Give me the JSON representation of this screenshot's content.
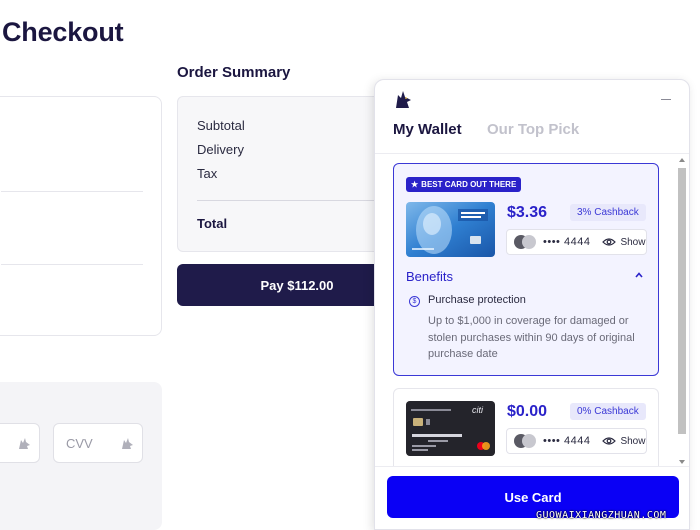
{
  "page": {
    "title": "Checkout"
  },
  "payment_form": {
    "cvv_placeholder": "CVV"
  },
  "order_summary": {
    "title": "Order Summary",
    "rows": [
      {
        "label": "Subtotal"
      },
      {
        "label": "Delivery"
      },
      {
        "label": "Tax"
      }
    ],
    "total_label": "Total",
    "pay_button": "Pay $112.00"
  },
  "wallet": {
    "tabs": [
      {
        "label": "My Wallet",
        "active": true
      },
      {
        "label": "Our Top Pick",
        "active": false
      }
    ],
    "cards": [
      {
        "badge": "BEST CARD OUT THERE",
        "card_type": "amex-blue",
        "amount": "$3.36",
        "cashback": "3% Cashback",
        "masked": "•••• 4444",
        "show_label": "Show",
        "benefits": {
          "label": "Benefits",
          "expanded": true,
          "items": [
            {
              "title": "Purchase protection",
              "description": "Up to $1,000 in coverage for damaged or stolen purchases within 90 days of original purchase date"
            }
          ]
        }
      },
      {
        "card_type": "citi-black",
        "amount": "$0.00",
        "cashback": "0% Cashback",
        "masked": "•••• 4444",
        "show_label": "Show"
      }
    ],
    "use_button": "Use Card"
  },
  "watermark": "GUOWAIXIANGZHUAN.COM",
  "colors": {
    "navy": "#1f1b4a",
    "accent": "#2a22c9",
    "primary_button": "#0a00f5"
  }
}
